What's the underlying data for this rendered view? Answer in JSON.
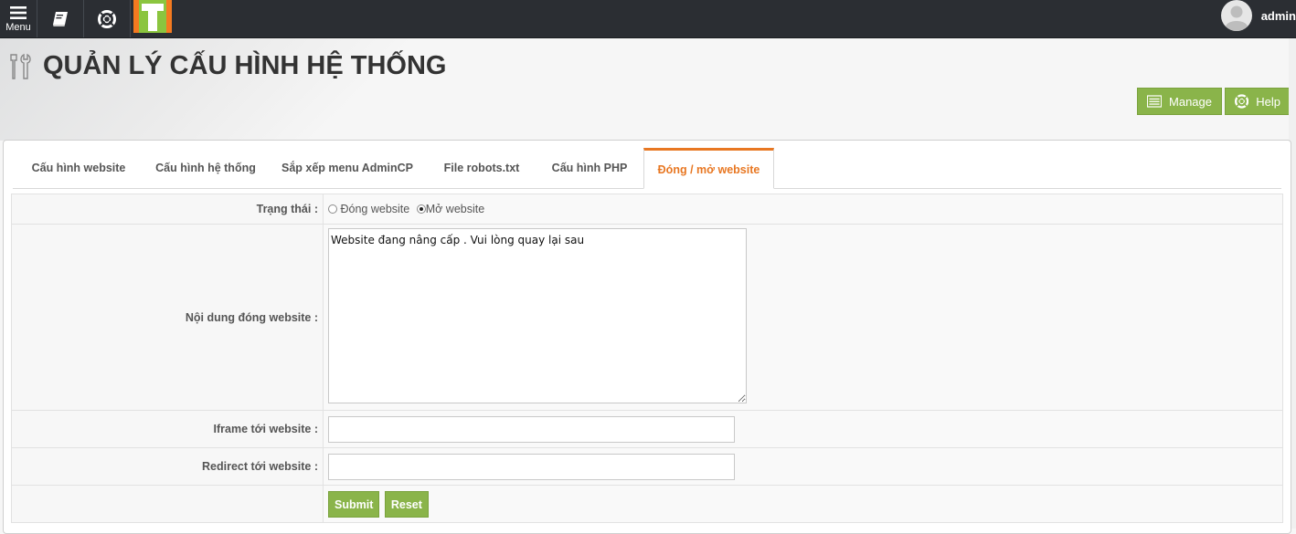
{
  "topbar": {
    "menu_label": "Menu",
    "user_name": "admin"
  },
  "header": {
    "title": "QUẢN LÝ CẤU HÌNH HỆ THỐNG",
    "manage_label": "Manage",
    "help_label": "Help"
  },
  "tabs": [
    {
      "label": "Cấu hình website"
    },
    {
      "label": "Cấu hình hệ thống"
    },
    {
      "label": "Sắp xếp menu AdminCP"
    },
    {
      "label": "File robots.txt"
    },
    {
      "label": "Cấu hình PHP"
    },
    {
      "label": "Đóng / mở website",
      "active": true
    }
  ],
  "form": {
    "status_label": "Trạng thái :",
    "status_options": [
      {
        "label": "Đóng website",
        "checked": false
      },
      {
        "label": "Mở website",
        "checked": true
      }
    ],
    "content_label": "Nội dung đóng website :",
    "content_value": "Website đang nâng cấp . Vui lòng quay lại sau",
    "iframe_label": "Iframe tới website :",
    "iframe_value": "",
    "redirect_label": "Redirect tới website :",
    "redirect_value": "",
    "submit_label": "Submit",
    "reset_label": "Reset"
  },
  "colors": {
    "accent": "#8ab44a",
    "active_tab": "#e87722",
    "topbar": "#2b2e33"
  }
}
